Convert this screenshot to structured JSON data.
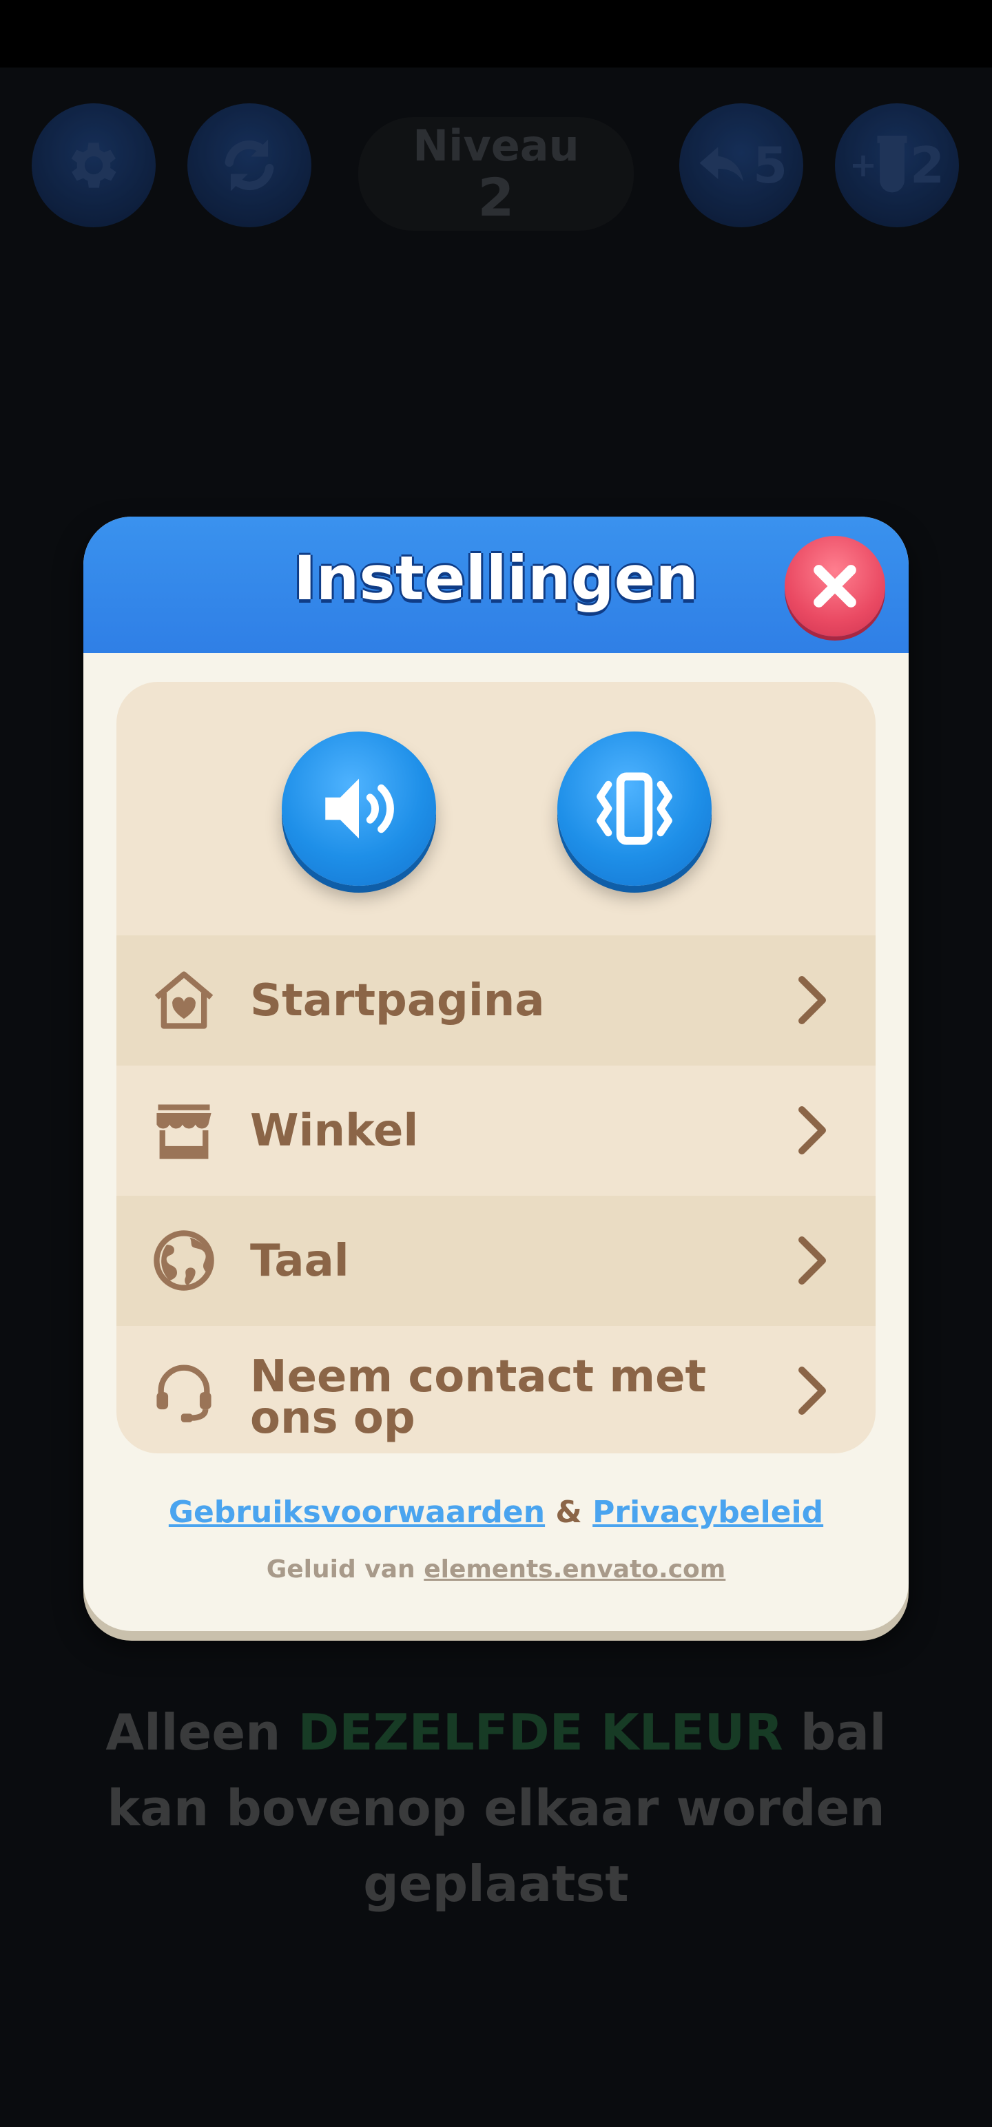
{
  "hud": {
    "level_label": "Niveau",
    "level_value": "2",
    "undo_count": "5",
    "add_tube_count": "2",
    "add_tube_prefix": "+"
  },
  "dialog": {
    "title": "Instellingen",
    "menu": [
      {
        "label": "Startpagina",
        "icon": "home-icon"
      },
      {
        "label": "Winkel",
        "icon": "shop-icon"
      },
      {
        "label": "Taal",
        "icon": "globe-icon"
      },
      {
        "label_line1": "Neem contact met",
        "label_line2": "ons op",
        "icon": "headset-icon"
      }
    ],
    "terms_link": "Gebruiksvoorwaarden",
    "ampersand": "&",
    "privacy_link": "Privacybeleid",
    "credit_prefix": "Geluid van",
    "credit_link": "elements.envato.com"
  },
  "hint": {
    "part1": "Alleen",
    "highlight": "DEZELFDE KLEUR",
    "part2": "bal",
    "line2": "kan bovenop elkaar worden",
    "line3": "geplaatst"
  },
  "colors": {
    "header_blue": "#2f7fe6",
    "close_red": "#ea4a63",
    "panel_beige": "#f1e4d0",
    "text_brown": "#8b6547",
    "link_blue": "#4aa4ef"
  }
}
